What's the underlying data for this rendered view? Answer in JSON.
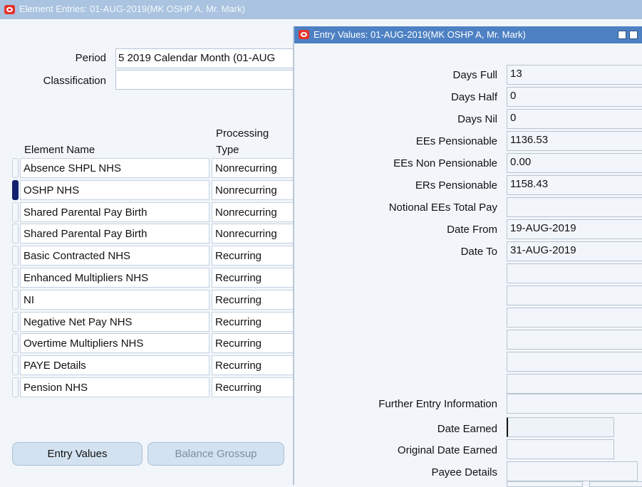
{
  "main_window": {
    "title": "Element Entries: 01-AUG-2019(MK OSHP A, Mr. Mark)",
    "period_label": "Period",
    "period_value": "5 2019 Calendar Month (01-AUG",
    "classification_label": "Classification",
    "classification_value": "",
    "columns": {
      "element_name": "Element Name",
      "processing_type_1": "Processing",
      "processing_type_2": "Type"
    },
    "rows": [
      {
        "name": "Absence SHPL NHS",
        "type": "Nonrecurring"
      },
      {
        "name": "OSHP NHS",
        "type": "Nonrecurring"
      },
      {
        "name": "Shared Parental Pay Birth",
        "type": "Nonrecurring"
      },
      {
        "name": "Shared Parental Pay Birth",
        "type": "Nonrecurring"
      },
      {
        "name": "Basic Contracted NHS",
        "type": "Recurring"
      },
      {
        "name": "Enhanced Multipliers NHS",
        "type": "Recurring"
      },
      {
        "name": "NI",
        "type": "Recurring"
      },
      {
        "name": "Negative Net Pay NHS",
        "type": "Recurring"
      },
      {
        "name": "Overtime Multipliers NHS",
        "type": "Recurring"
      },
      {
        "name": "PAYE Details",
        "type": "Recurring"
      },
      {
        "name": "Pension NHS",
        "type": "Recurring"
      }
    ],
    "selected_row": 1,
    "buttons": {
      "entry_values": "Entry Values",
      "balance_grossup": "Balance Grossup"
    }
  },
  "entry_values_window": {
    "title": "Entry Values: 01-AUG-2019(MK OSHP A, Mr. Mark)",
    "fields": [
      {
        "label": "Days Full",
        "value": "13"
      },
      {
        "label": "Days Half",
        "value": "0"
      },
      {
        "label": "Days Nil",
        "value": "0"
      },
      {
        "label": "EEs Pensionable",
        "value": "1136.53"
      },
      {
        "label": "EEs Non Pensionable",
        "value": "0.00"
      },
      {
        "label": "ERs Pensionable",
        "value": "1158.43"
      },
      {
        "label": "Notional EEs Total Pay",
        "value": ""
      },
      {
        "label": "Date From",
        "value": "19-AUG-2019"
      },
      {
        "label": "Date To",
        "value": "31-AUG-2019"
      },
      {
        "label": "",
        "value": ""
      },
      {
        "label": "",
        "value": ""
      },
      {
        "label": "",
        "value": ""
      },
      {
        "label": "",
        "value": ""
      },
      {
        "label": "",
        "value": ""
      },
      {
        "label": "",
        "value": ""
      }
    ],
    "further_entry_information_label": "Further Entry Information",
    "further_entry_information_value": "",
    "date_earned_label": "Date Earned",
    "date_earned_value": "",
    "original_date_earned_label": "Original Date Earned",
    "original_date_earned_value": "",
    "payee_details_label": "Payee Details",
    "payee_details_value": ""
  },
  "colors": {
    "title_inactive": "#a9c3e0",
    "title_active": "#4d81c3",
    "selected_indicator": "#12206e",
    "oracle_red": "#e6322c"
  }
}
